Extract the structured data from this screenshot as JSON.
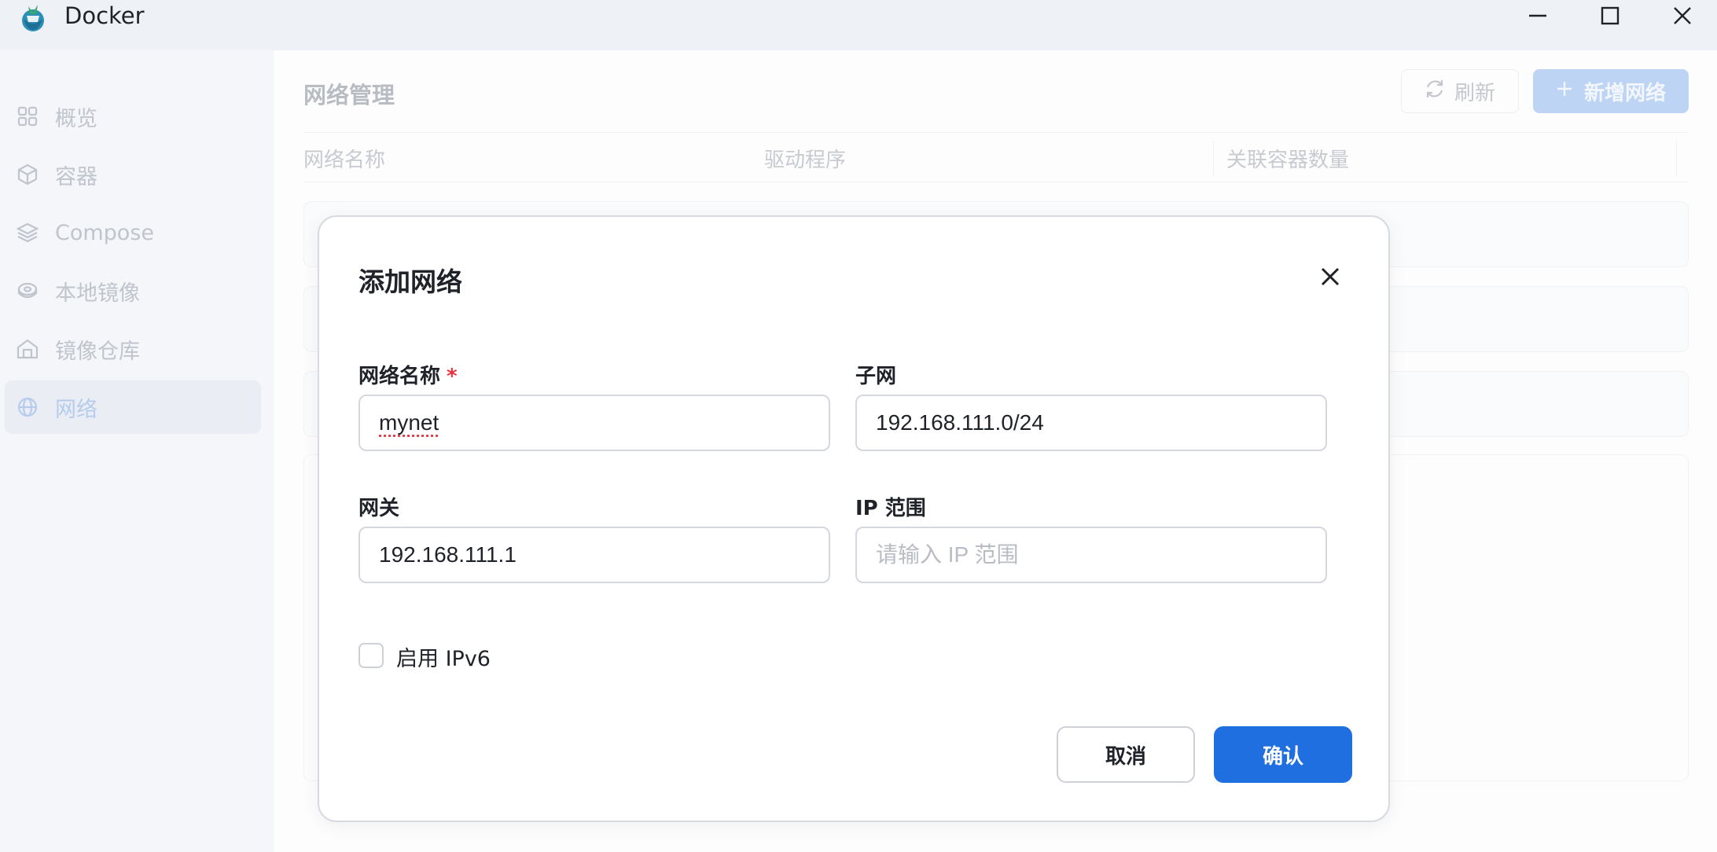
{
  "window": {
    "title": "Docker"
  },
  "sidebar": {
    "items": [
      {
        "label": "概览",
        "icon": "grid-icon"
      },
      {
        "label": "容器",
        "icon": "box-icon"
      },
      {
        "label": "Compose",
        "icon": "layers-icon"
      },
      {
        "label": "本地镜像",
        "icon": "disk-icon"
      },
      {
        "label": "镜像仓库",
        "icon": "warehouse-icon"
      },
      {
        "label": "网络",
        "icon": "globe-icon",
        "active": true
      }
    ]
  },
  "page": {
    "title": "网络管理",
    "refresh_label": "刷新",
    "add_label": "新增网络",
    "columns": [
      "网络名称",
      "驱动程序",
      "关联容器数量"
    ]
  },
  "dialog": {
    "title": "添加网络",
    "name": {
      "label": "网络名称",
      "required_mark": "*",
      "value": "mynet"
    },
    "subnet": {
      "label": "子网",
      "value": "192.168.111.0/24"
    },
    "gateway": {
      "label": "网关",
      "value": "192.168.111.1"
    },
    "ip_range": {
      "label": "IP 范围",
      "placeholder": "请输入 IP 范围",
      "value": ""
    },
    "ipv6": {
      "label": "启用 IPv6",
      "checked": false
    },
    "cancel_label": "取消",
    "confirm_label": "确认"
  },
  "colors": {
    "primary": "#1f6fe0",
    "required": "#e5323e"
  }
}
